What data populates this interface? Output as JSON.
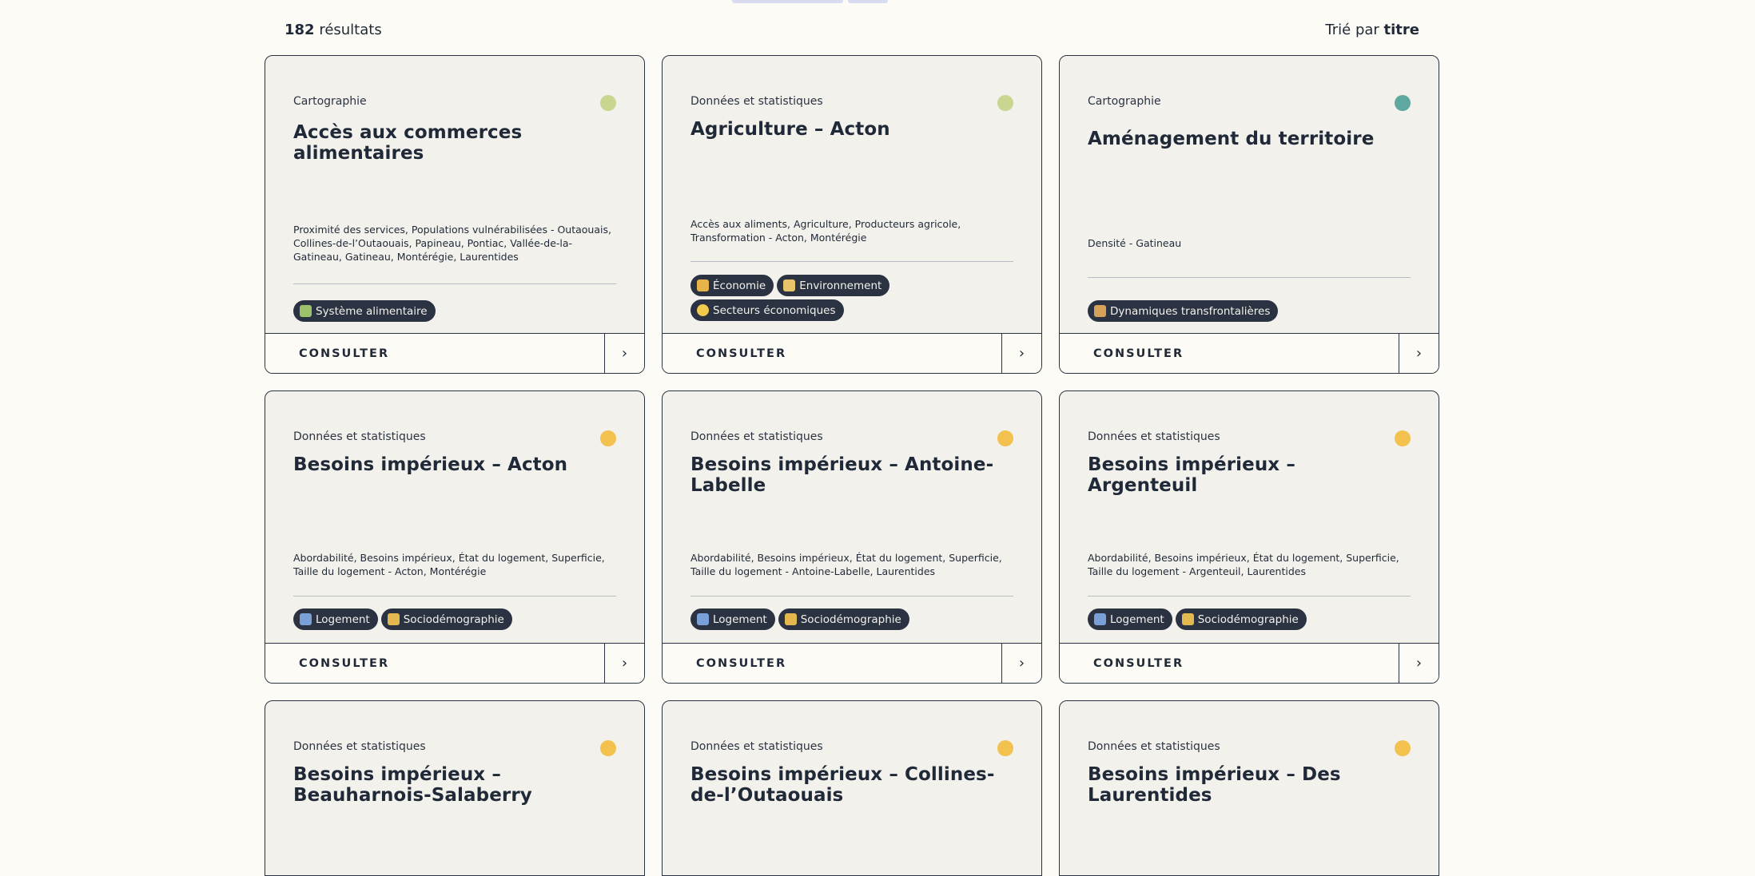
{
  "results": {
    "count": "182",
    "label": "résultats",
    "sort_prefix": "Trié par",
    "sort_value": "titre"
  },
  "consult_label": "CONSULTER",
  "arrow_glyph": "›",
  "cards": [
    {
      "type": "Cartographie",
      "dot_color": "#c9d68f",
      "title": "Accès aux commerces alimentaires",
      "desc": "Proximité des services, Populations vulnérabilisées - Outaouais, Collines-de-l’Outaouais, Papineau, Pontiac, Vallée-de-la-Gatineau, Gatineau, Montérégie, Laurentides",
      "tags": [
        {
          "label": "Système alimentaire",
          "icon": "plant-icon",
          "color": "#9cc36b"
        }
      ]
    },
    {
      "type": "Données et statistiques",
      "dot_color": "#c9d68f",
      "title": "Agriculture – Acton",
      "desc": "Accès aux aliments, Agriculture, Producteurs agricole, Transformation - Acton, Montérégie",
      "tags": [
        {
          "label": "Économie",
          "icon": "coins-icon",
          "color": "#e7b44a"
        },
        {
          "label": "Environnement",
          "icon": "leaf-icon",
          "color": "#e9c36a"
        },
        {
          "label": "Secteurs économiques",
          "icon": "gear-icon",
          "color": "#f2c94c"
        }
      ]
    },
    {
      "type": "Cartographie",
      "dot_color": "#5ea8a0",
      "title": "Aménagement du territoire",
      "desc": "Densité - Gatineau",
      "tags": [
        {
          "label": "Dynamiques transfrontalières",
          "icon": "border-icon",
          "color": "#d6a25a"
        }
      ]
    },
    {
      "type": "Données et statistiques",
      "dot_color": "#f2c14e",
      "title": "Besoins impérieux – Acton",
      "desc": "Abordabilité, Besoins impérieux, État du logement, Superficie, Taille du logement - Acton, Montérégie",
      "tags": [
        {
          "label": "Logement",
          "icon": "house-icon",
          "color": "#7aa0d8"
        },
        {
          "label": "Sociodémographie",
          "icon": "people-icon",
          "color": "#e2b84f"
        }
      ]
    },
    {
      "type": "Données et statistiques",
      "dot_color": "#f2c14e",
      "title": "Besoins impérieux – Antoine-Labelle",
      "desc": "Abordabilité, Besoins impérieux, État du logement, Superficie, Taille du logement - Antoine-Labelle, Laurentides",
      "tags": [
        {
          "label": "Logement",
          "icon": "house-icon",
          "color": "#7aa0d8"
        },
        {
          "label": "Sociodémographie",
          "icon": "people-icon",
          "color": "#e2b84f"
        }
      ]
    },
    {
      "type": "Données et statistiques",
      "dot_color": "#f2c14e",
      "title": "Besoins impérieux – Argenteuil",
      "desc": "Abordabilité, Besoins impérieux, État du logement, Superficie, Taille du logement - Argenteuil, Laurentides",
      "tags": [
        {
          "label": "Logement",
          "icon": "house-icon",
          "color": "#7aa0d8"
        },
        {
          "label": "Sociodémographie",
          "icon": "people-icon",
          "color": "#e2b84f"
        }
      ]
    },
    {
      "type": "Données et statistiques",
      "dot_color": "#f2c14e",
      "title": "Besoins impérieux – Beauharnois-Salaberry",
      "desc": "",
      "tags": []
    },
    {
      "type": "Données et statistiques",
      "dot_color": "#f2c14e",
      "title": "Besoins impérieux – Collines-de-l’Outaouais",
      "desc": "",
      "tags": []
    },
    {
      "type": "Données et statistiques",
      "dot_color": "#f2c14e",
      "title": "Besoins impérieux – Des Laurentides",
      "desc": "",
      "tags": []
    }
  ]
}
